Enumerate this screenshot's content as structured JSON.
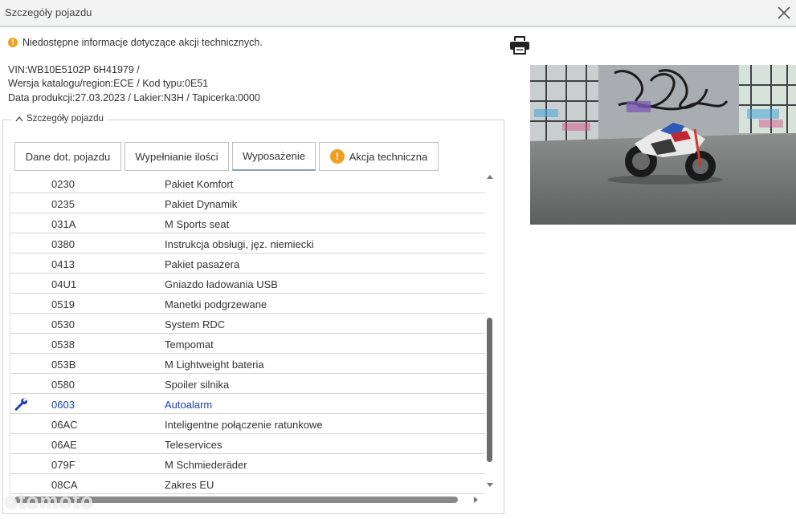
{
  "window": {
    "title": "Szczegóły pojazdu"
  },
  "warning": {
    "text": "Niedostępne informacje dotyczące akcji technicznych."
  },
  "vehicle": {
    "line1": "VIN:WB10E5102P 6H41979 /",
    "line2": "Wersja katalogu/region:ECE / Kod typu:0E51",
    "line3": "Data produkcji:27.03.2023 / Lakier:N3H / Tapicerka:0000"
  },
  "section": {
    "legend": "Szczegóły pojazdu"
  },
  "tabs": [
    {
      "label": "Dane dot. pojazdu",
      "active": false,
      "warning": false
    },
    {
      "label": "Wypełnianie ilości",
      "active": false,
      "warning": false
    },
    {
      "label": "Wyposażenie",
      "active": true,
      "warning": false
    },
    {
      "label": "Akcja techniczna",
      "active": false,
      "warning": true
    }
  ],
  "equipment": [
    {
      "code": "0230",
      "desc": "Pakiet Komfort"
    },
    {
      "code": "0235",
      "desc": "Pakiet Dynamik"
    },
    {
      "code": "031A",
      "desc": "M Sports seat"
    },
    {
      "code": "0380",
      "desc": "Instrukcja obsługi, jęz. niemiecki"
    },
    {
      "code": "0413",
      "desc": "Pakiet pasażera"
    },
    {
      "code": "04U1",
      "desc": "Gniazdo ładowania USB"
    },
    {
      "code": "0519",
      "desc": "Manetki podgrzewane"
    },
    {
      "code": "0530",
      "desc": "System RDC"
    },
    {
      "code": "0538",
      "desc": "Tempomat"
    },
    {
      "code": "053B",
      "desc": "M Lightweight bateria"
    },
    {
      "code": "0580",
      "desc": "Spoiler silnika"
    },
    {
      "code": "0603",
      "desc": "Autoalarm",
      "highlight": true
    },
    {
      "code": "06AC",
      "desc": "Inteligentne połączenie ratunkowe"
    },
    {
      "code": "06AE",
      "desc": "Teleservices"
    },
    {
      "code": "079F",
      "desc": "M Schmiederäder"
    },
    {
      "code": "08CA",
      "desc": "Zakres EU"
    }
  ],
  "watermark": "otomoto",
  "colors": {
    "warning": "#f0a020",
    "highlight": "#1a3fb0",
    "accent": "#c9d2dc"
  }
}
